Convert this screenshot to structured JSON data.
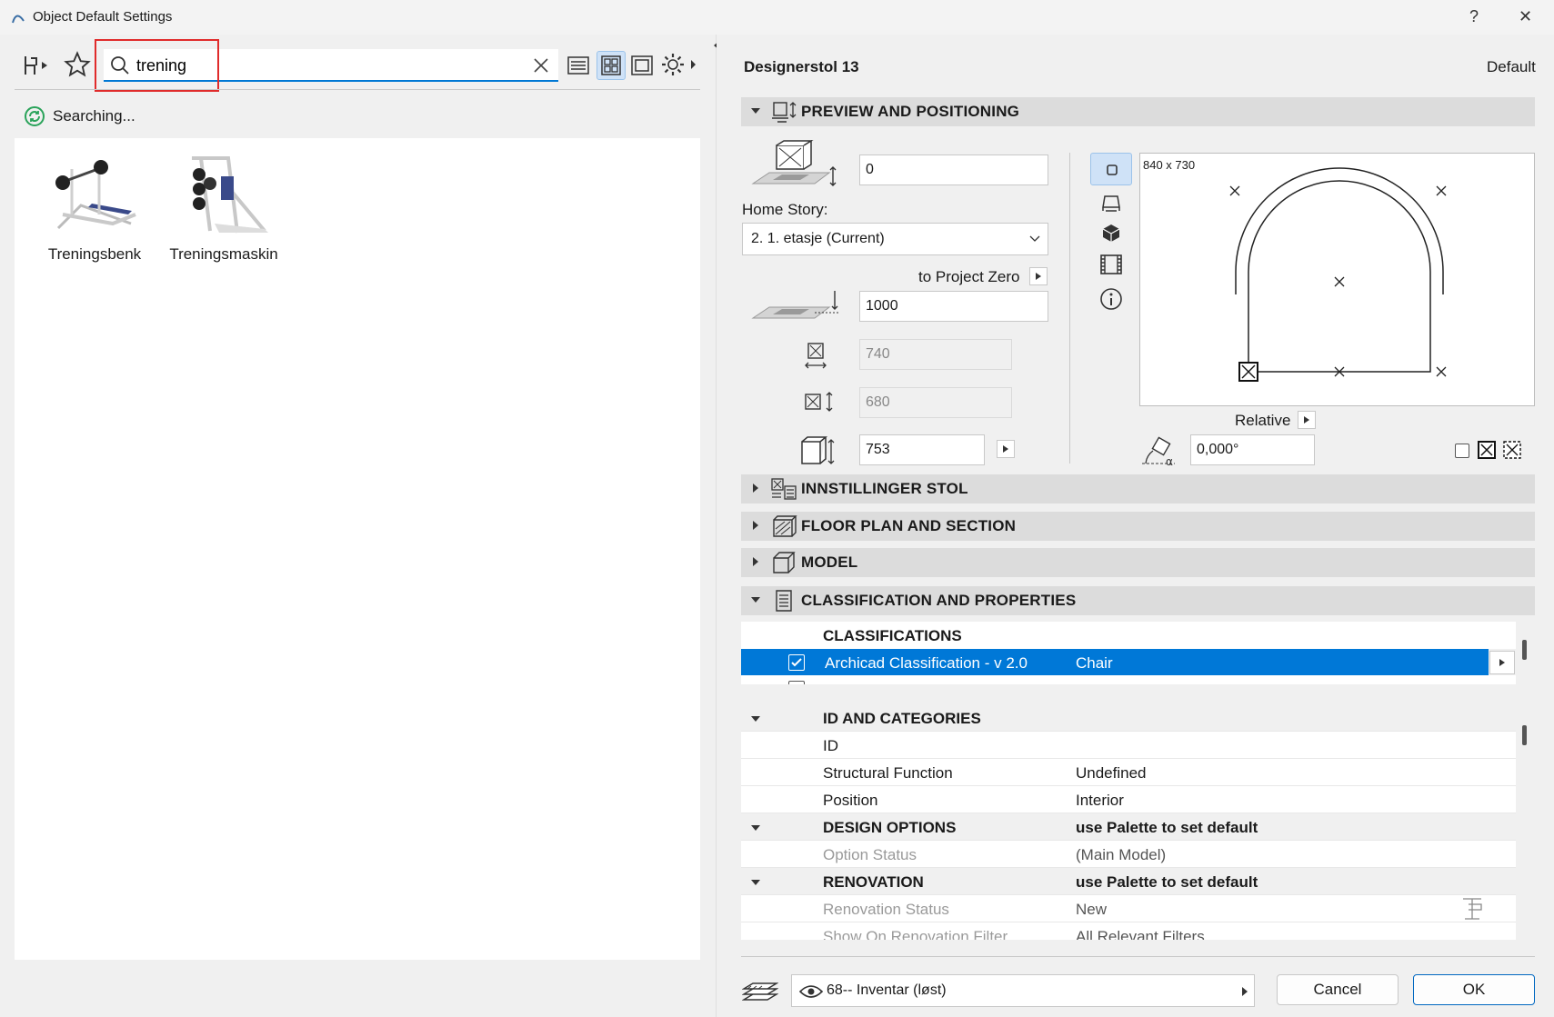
{
  "window": {
    "title": "Object Default Settings",
    "help": "?",
    "close": "✕"
  },
  "search": {
    "value": "trening",
    "placeholder": ""
  },
  "status": {
    "text": "Searching..."
  },
  "results": [
    {
      "label": "Treningsbenk"
    },
    {
      "label": "Treningsmaskin"
    }
  ],
  "header": {
    "object_name": "Designerstol 13",
    "default_label": "Default"
  },
  "sections": {
    "preview": "PREVIEW AND POSITIONING",
    "innstillinger": "INNSTILLINGER STOL",
    "floorplan": "FLOOR PLAN AND SECTION",
    "model": "MODEL",
    "classification": "CLASSIFICATION AND PROPERTIES"
  },
  "preview": {
    "top_offset": "0",
    "home_story_label": "Home Story:",
    "home_story_value": "2. 1. etasje (Current)",
    "to_project_zero": "to Project Zero",
    "elevation": "1000",
    "width": "740",
    "depth": "680",
    "height": "753",
    "size_caption": "840 x 730",
    "relative_label": "Relative",
    "angle": "0,000°"
  },
  "classifications": {
    "header": "CLASSIFICATIONS",
    "rows": [
      {
        "system": "Archicad Classification - v 2.0",
        "value": "Chair",
        "checked": true
      }
    ]
  },
  "properties": [
    {
      "type": "group",
      "c1": "ID AND CATEGORIES",
      "c2": ""
    },
    {
      "type": "row",
      "c1": "ID",
      "c2": ""
    },
    {
      "type": "row",
      "c1": "Structural Function",
      "c2": "Undefined"
    },
    {
      "type": "row",
      "c1": "Position",
      "c2": "Interior"
    },
    {
      "type": "group",
      "c1": "DESIGN OPTIONS",
      "c2": "use Palette to set default"
    },
    {
      "type": "dim",
      "c1": "Option Status",
      "c2": "(Main Model)"
    },
    {
      "type": "group",
      "c1": "RENOVATION",
      "c2": "use Palette to set default"
    },
    {
      "type": "dim",
      "c1": "Renovation Status",
      "c2": "New"
    },
    {
      "type": "dim",
      "c1": "Show On Renovation Filter",
      "c2": "All Relevant Filters"
    }
  ],
  "footer": {
    "layer": "68-- Inventar (løst)",
    "cancel": "Cancel",
    "ok": "OK"
  },
  "colors": {
    "accent": "#0078d4",
    "selection": "#0078d7",
    "highlight_box": "#e02b2b"
  }
}
